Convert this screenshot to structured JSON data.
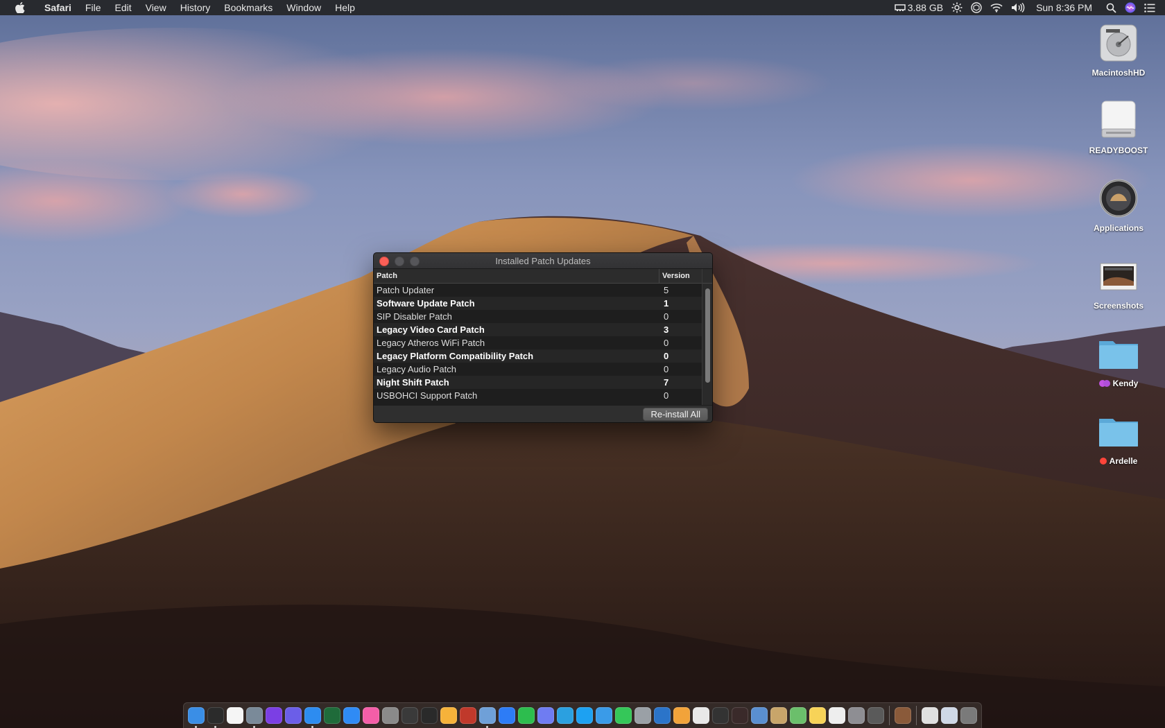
{
  "menubar": {
    "app_name": "Safari",
    "items": [
      "File",
      "Edit",
      "View",
      "History",
      "Bookmarks",
      "Window",
      "Help"
    ],
    "memory": "3.88 GB",
    "clock": "Sun 8:36 PM"
  },
  "desktop": {
    "icons": [
      {
        "label": "MacintoshHD"
      },
      {
        "label": "READYBOOST"
      },
      {
        "label": "Applications"
      },
      {
        "label": "Screenshots"
      },
      {
        "label": "Kendy",
        "tag_colors": [
          "#c252e1",
          "#b04fd9"
        ]
      },
      {
        "label": "Ardelle",
        "tag_colors": [
          "#ff453a"
        ]
      }
    ]
  },
  "window": {
    "title": "Installed Patch Updates",
    "columns": {
      "patch": "Patch",
      "version": "Version"
    },
    "rows": [
      {
        "patch": "Patch Updater",
        "version": "5"
      },
      {
        "patch": "Software Update Patch",
        "version": "1"
      },
      {
        "patch": "SIP Disabler Patch",
        "version": "0"
      },
      {
        "patch": "Legacy Video Card Patch",
        "version": "3"
      },
      {
        "patch": "Legacy Atheros WiFi Patch",
        "version": "0"
      },
      {
        "patch": "Legacy Platform Compatibility Patch",
        "version": "0"
      },
      {
        "patch": "Legacy Audio Patch",
        "version": "0"
      },
      {
        "patch": "Night Shift Patch",
        "version": "7"
      },
      {
        "patch": "USBOHCI Support Patch",
        "version": "0"
      }
    ],
    "button_label": "Re-install All"
  },
  "dock": {
    "apps": [
      {
        "icon": "finder-icon",
        "color": "#3a8ee6"
      },
      {
        "icon": "clock-icon",
        "color": "#2b2b2b"
      },
      {
        "icon": "calendar-icon",
        "color": "#f5f5f5"
      },
      {
        "icon": "cleaner-icon",
        "color": "#7a8a99"
      },
      {
        "icon": "siri-icon",
        "color": "#7b3fe4"
      },
      {
        "icon": "launchpad-icon",
        "color": "#6b5ee8"
      },
      {
        "icon": "safari-icon",
        "color": "#2d8cf0"
      },
      {
        "icon": "opera-icon",
        "color": "#1f6b3a"
      },
      {
        "icon": "app-store-icon",
        "color": "#2f8bf5"
      },
      {
        "icon": "itunes-icon",
        "color": "#f45ea8"
      },
      {
        "icon": "rocket-icon",
        "color": "#8a8a8a"
      },
      {
        "icon": "activity-icon",
        "color": "#3a3a3a"
      },
      {
        "icon": "stocks-icon",
        "color": "#2a2a2a"
      },
      {
        "icon": "photos-icon",
        "color": "#f6b23a"
      },
      {
        "icon": "photo-booth-icon",
        "color": "#c0392b"
      },
      {
        "icon": "preview-icon",
        "color": "#6fa0d8"
      },
      {
        "icon": "messenger-icon",
        "color": "#2d7cf6"
      },
      {
        "icon": "whatsapp-icon",
        "color": "#2dbd4e"
      },
      {
        "icon": "discord-icon",
        "color": "#6f7cf2"
      },
      {
        "icon": "telegram-icon",
        "color": "#2ba0e0"
      },
      {
        "icon": "twitter-icon",
        "color": "#1da1f2"
      },
      {
        "icon": "messages-icon",
        "color": "#3a9be8"
      },
      {
        "icon": "facetime-icon",
        "color": "#35c759"
      },
      {
        "icon": "disk-icon",
        "color": "#9aa0a6"
      },
      {
        "icon": "edge-icon",
        "color": "#2b74c9"
      },
      {
        "icon": "home-icon",
        "color": "#f2a33a"
      },
      {
        "icon": "news-icon",
        "color": "#e8e8e8"
      },
      {
        "icon": "monitor-icon",
        "color": "#333333"
      },
      {
        "icon": "dictionary-icon",
        "color": "#3a2a2a"
      },
      {
        "icon": "preview-doc-icon",
        "color": "#5a8fd0"
      },
      {
        "icon": "contacts-icon",
        "color": "#c8a56a"
      },
      {
        "icon": "maps-icon",
        "color": "#6bbf6b"
      },
      {
        "icon": "notes-icon",
        "color": "#f7d358"
      },
      {
        "icon": "textedit-icon",
        "color": "#eeeeee"
      },
      {
        "icon": "system-preferences-icon",
        "color": "#8e8e93"
      },
      {
        "icon": "disk-utility-icon",
        "color": "#5a5a5a"
      }
    ],
    "extras": [
      {
        "icon": "mojave-icon",
        "color": "#8a5a3a"
      },
      {
        "icon": "downloads-icon",
        "color": "#e0e0e0"
      },
      {
        "icon": "documents-icon",
        "color": "#cfd8e6"
      },
      {
        "icon": "trash-icon",
        "color": "#7a7a7a"
      }
    ]
  }
}
